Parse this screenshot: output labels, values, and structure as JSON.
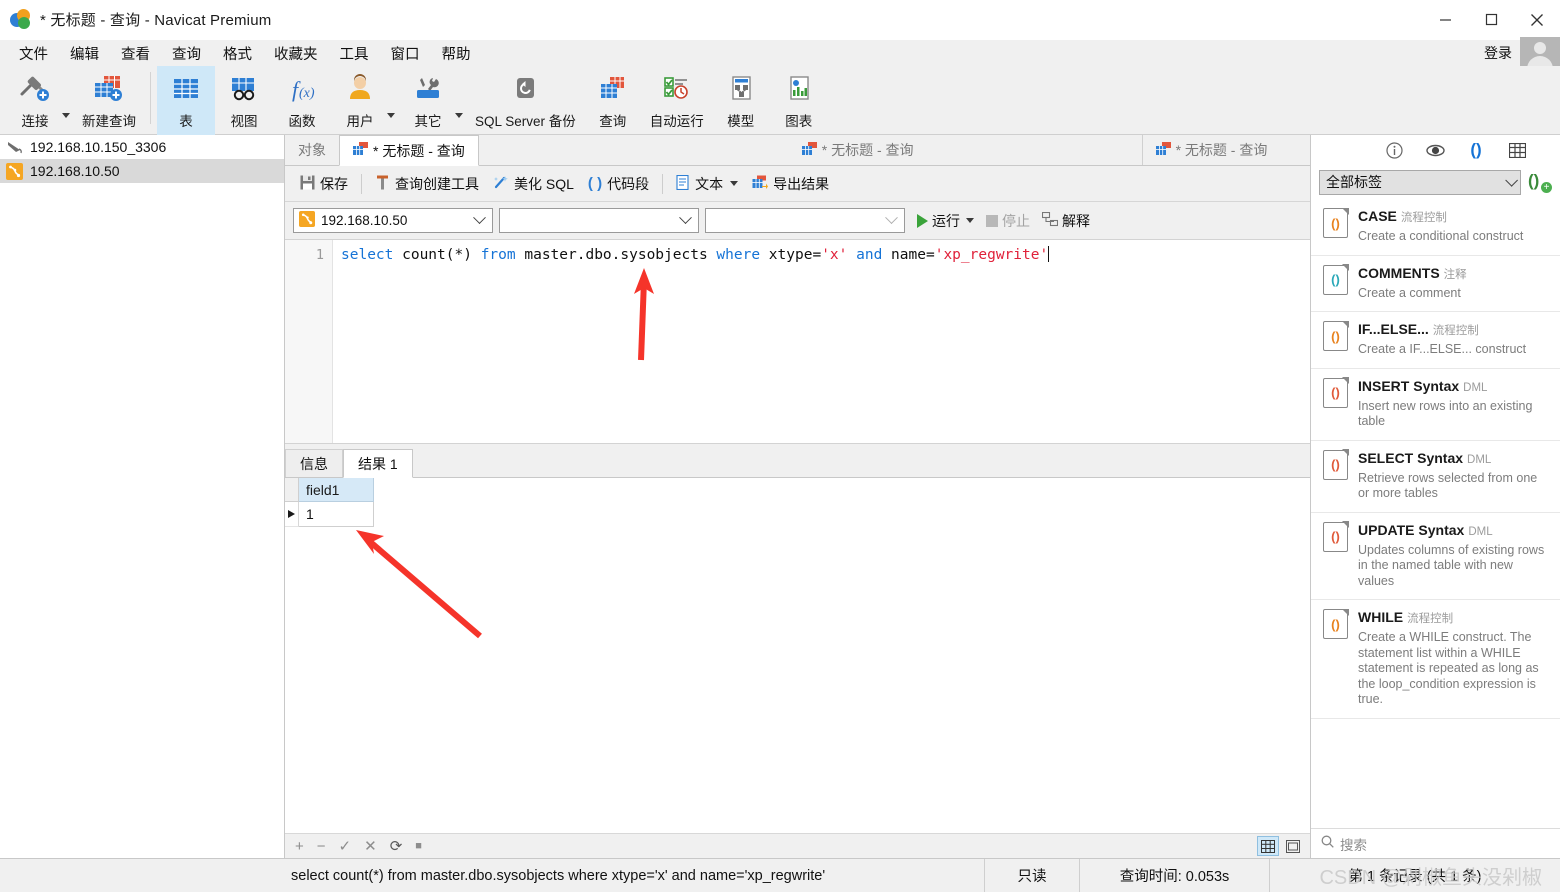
{
  "window": {
    "title": "* 无标题 - 查询 - Navicat Premium",
    "minimize": "—",
    "maximize": "□",
    "close": "✕"
  },
  "menubar": {
    "items": [
      {
        "label": "文件"
      },
      {
        "label": "编辑"
      },
      {
        "label": "查看"
      },
      {
        "label": "查询"
      },
      {
        "label": "格式"
      },
      {
        "label": "收藏夹"
      },
      {
        "label": "工具"
      },
      {
        "label": "窗口"
      },
      {
        "label": "帮助"
      }
    ],
    "login_label": "登录"
  },
  "ribbon": {
    "buttons": [
      {
        "label": "连接",
        "icon": "connection-icon",
        "has_caret": true,
        "selected": false
      },
      {
        "label": "新建查询",
        "icon": "new-query-icon",
        "has_caret": false,
        "selected": false
      },
      {
        "label": "表",
        "icon": "table-icon",
        "has_caret": false,
        "selected": true
      },
      {
        "label": "视图",
        "icon": "view-icon",
        "has_caret": false,
        "selected": false
      },
      {
        "label": "函数",
        "icon": "function-icon",
        "has_caret": false,
        "selected": false
      },
      {
        "label": "用户",
        "icon": "user-icon",
        "has_caret": true,
        "selected": false
      },
      {
        "label": "其它",
        "icon": "other-tools-icon",
        "has_caret": true,
        "selected": false
      },
      {
        "label": "SQL Server 备份",
        "icon": "backup-icon",
        "has_caret": false,
        "selected": false
      },
      {
        "label": "查询",
        "icon": "query-icon",
        "has_caret": false,
        "selected": false
      },
      {
        "label": "自动运行",
        "icon": "automation-icon",
        "has_caret": false,
        "selected": false
      },
      {
        "label": "模型",
        "icon": "model-icon",
        "has_caret": false,
        "selected": false
      },
      {
        "label": "图表",
        "icon": "chart-icon",
        "has_caret": false,
        "selected": false
      }
    ]
  },
  "sidebar": {
    "connections": [
      {
        "label": "192.168.10.150_3306",
        "type": "mysql",
        "selected": false
      },
      {
        "label": "192.168.10.50",
        "type": "sqlserver",
        "selected": true
      }
    ]
  },
  "tabs": [
    {
      "label": "对象",
      "active": false,
      "has_icon": false
    },
    {
      "label": "* 无标题 - 查询",
      "active": true,
      "has_icon": true
    },
    {
      "label": "* 无标题 - 查询",
      "active": false,
      "has_icon": true
    },
    {
      "label": "* 无标题 - 查询",
      "active": false,
      "has_icon": true
    }
  ],
  "query_toolbar": {
    "save": "保存",
    "query_builder": "查询创建工具",
    "beautify_sql": "美化 SQL",
    "snippet": "代码段",
    "text": "文本",
    "export_result": "导出结果"
  },
  "selector_bar": {
    "connection": "192.168.10.50",
    "database": "",
    "extra": "",
    "run": "运行",
    "stop": "停止",
    "explain": "解释"
  },
  "editor": {
    "line_numbers": [
      "1"
    ],
    "sql_tokens": [
      {
        "t": "select",
        "k": "kw"
      },
      {
        "t": " count(*) ",
        "k": "plain"
      },
      {
        "t": "from",
        "k": "kw"
      },
      {
        "t": " master.dbo.sysobjects ",
        "k": "plain"
      },
      {
        "t": "where",
        "k": "kw"
      },
      {
        "t": " xtype=",
        "k": "plain"
      },
      {
        "t": "'x'",
        "k": "str"
      },
      {
        "t": " ",
        "k": "plain"
      },
      {
        "t": "and",
        "k": "kw"
      },
      {
        "t": " name=",
        "k": "plain"
      },
      {
        "t": "'xp_regwrite'",
        "k": "str"
      }
    ],
    "sql_plain": "select count(*) from master.dbo.sysobjects where xtype='x' and name='xp_regwrite'"
  },
  "result_tabs": [
    {
      "label": "信息",
      "active": false
    },
    {
      "label": "结果 1",
      "active": true
    }
  ],
  "result_grid": {
    "columns": [
      "field1"
    ],
    "rows": [
      [
        "1"
      ]
    ]
  },
  "grid_toolbar": {
    "add": "+",
    "remove": "−",
    "confirm": "✓",
    "cancel": "✕",
    "refresh": "⟳",
    "stop": "■"
  },
  "right_panel": {
    "tab_icons": [
      {
        "name": "info-icon",
        "glyph": "ⓘ",
        "active": false
      },
      {
        "name": "preview-eye-icon",
        "glyph": "◉",
        "active": false
      },
      {
        "name": "code-snippet-icon",
        "glyph": "()",
        "active": true
      },
      {
        "name": "table-structure-icon",
        "glyph": "▤",
        "active": false
      }
    ],
    "filter_value": "全部标签",
    "add_snippet_label": "()",
    "search_placeholder": "搜索",
    "snippets": [
      {
        "title": "CASE",
        "category": "流程控制",
        "desc": "Create a conditional construct"
      },
      {
        "title": "COMMENTS",
        "category": "注释",
        "desc": "Create a comment"
      },
      {
        "title": "IF...ELSE...",
        "category": "流程控制",
        "desc": "Create a IF...ELSE... construct"
      },
      {
        "title": "INSERT Syntax",
        "category": "DML",
        "desc": "Insert new rows into an existing table"
      },
      {
        "title": "SELECT Syntax",
        "category": "DML",
        "desc": "Retrieve rows selected from one or more tables"
      },
      {
        "title": "UPDATE Syntax",
        "category": "DML",
        "desc": "Updates columns of existing rows in the named table with new values"
      },
      {
        "title": "WHILE",
        "category": "流程控制",
        "desc": "Create a WHILE construct. The statement list within a WHILE statement is repeated as long as the loop_condition expression is true."
      }
    ]
  },
  "status_bar": {
    "sql": "select count(*) from master.dbo.sysobjects where xtype='x' and name='xp_regwrite'",
    "readonly": "只读",
    "query_time": "查询时间: 0.053s",
    "record_info": "第 1 条记录 (共 1 条)"
  },
  "watermark": "CSDN @剁椒鱼头没剁椒",
  "colors": {
    "accent": "#1573d6",
    "selection": "#cfe8f8",
    "keyword": "#1573d6",
    "string": "#e0213a",
    "annotation_red": "#f5342a",
    "grid_header": "#d6e9f7"
  }
}
